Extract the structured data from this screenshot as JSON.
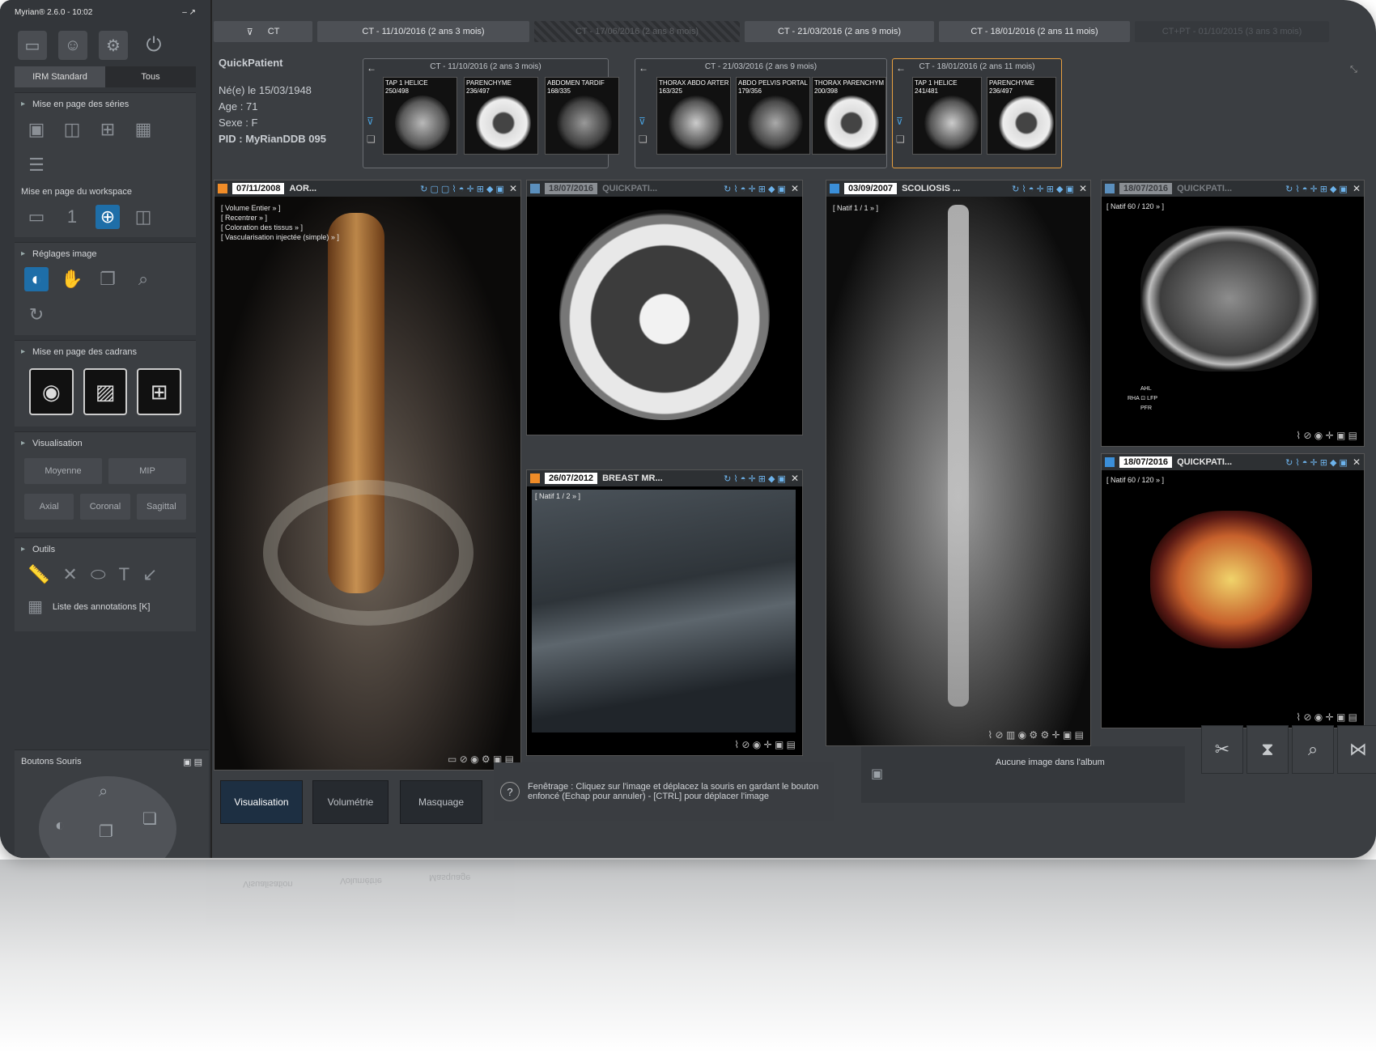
{
  "app": {
    "title": "Myrian® 2.6.0 - 10:02"
  },
  "sidebar": {
    "tabs": [
      "IRM Standard",
      "Tous"
    ],
    "main_icons": [
      "folder-icon",
      "user-icon",
      "settings-icon",
      "power-icon"
    ],
    "sections": {
      "series_layout": "Mise en page des séries",
      "workspace_layout": "Mise en page du workspace",
      "image_settings": "Réglages image",
      "frame_layout": "Mise en page des cadrans",
      "visualisation": "Visualisation",
      "tools": "Outils",
      "mouse_buttons": "Boutons Souris"
    },
    "workspace_selected": "1",
    "visualisation_buttons": [
      "Moyenne",
      "MIP",
      "Axial",
      "Coronal",
      "Sagittal"
    ],
    "annotations_label": "Liste des annotations [K]"
  },
  "study_tabs": [
    {
      "label": "CT",
      "state": "active"
    },
    {
      "label": "CT - 11/10/2016 (2 ans 3 mois)",
      "state": "normal"
    },
    {
      "label": "CT - 17/06/2016 (2 ans 8 mois)",
      "state": "hatched"
    },
    {
      "label": "CT - 21/03/2016 (2 ans 9 mois)",
      "state": "normal"
    },
    {
      "label": "CT - 18/01/2016 (2 ans 11 mois)",
      "state": "normal"
    },
    {
      "label": "CT+PT - 01/10/2015 (3 ans 3 mois)",
      "state": "dim"
    }
  ],
  "patient": {
    "name": "QuickPatient",
    "born": "Né(e) le 15/03/1948",
    "age": "Age : 71",
    "sex": "Sexe : F",
    "pid": "PID : MyRianDDB 095"
  },
  "series_groups": [
    {
      "title": "CT - 11/10/2016 (2 ans 3 mois)",
      "series": [
        {
          "label": "TAP 1 HELICE",
          "count": "250/498"
        },
        {
          "label": "PARENCHYME",
          "count": "236/497"
        },
        {
          "label": "ABDOMEN TARDIF",
          "count": "168/335"
        }
      ]
    },
    {
      "title": "CT - 21/03/2016 (2 ans 9 mois)",
      "series": [
        {
          "label": "THORAX ABDO ARTER",
          "count": "163/325"
        },
        {
          "label": "ABDO PELVIS PORTAL",
          "count": "179/356"
        },
        {
          "label": "THORAX PARENCHYM",
          "count": "200/398"
        }
      ]
    },
    {
      "title": "CT - 18/01/2016 (2 ans 11 mois)",
      "series": [
        {
          "label": "TAP 1 HELICE",
          "count": "241/481"
        },
        {
          "label": "PARENCHYME",
          "count": "236/497"
        }
      ]
    }
  ],
  "viewports": [
    {
      "date": "07/11/2008",
      "title": "AOR...",
      "overlay": [
        "[ Volume Entier » ]",
        "[ Recentrer » ]",
        "[ Coloration des tissus » ]",
        "[ Vascularisation injectée (simple) » ]"
      ]
    },
    {
      "date": "18/07/2016",
      "title": "QUICKPATI..."
    },
    {
      "date": "26/07/2012",
      "title": "BREAST MR...",
      "overlay": [
        "[ Natif 1 / 2 » ]"
      ]
    },
    {
      "date": "03/09/2007",
      "title": "SCOLIOSIS ...",
      "overlay": [
        "[ Natif 1 / 1 » ]"
      ]
    },
    {
      "date": "18/07/2016",
      "title": "QUICKPATI...",
      "overlay": [
        "[ Natif 60 / 120 » ]"
      ],
      "orientation": [
        "AHL",
        "RHA",
        "LFP",
        "PFR"
      ]
    },
    {
      "date": "18/07/2016",
      "title": "QUICKPATI...",
      "overlay": [
        "[ Natif 60 / 120 » ]"
      ]
    }
  ],
  "bottom": {
    "tabs": [
      "Visualisation",
      "Volumétrie",
      "Masquage"
    ],
    "help": "Fenêtrage : Cliquez sur l'image et déplacez la souris en gardant le bouton enfoncé (Echap pour annuler) - [CTRL] pour déplacer l'image",
    "album_empty": "Aucune image dans l'album"
  },
  "colors": {
    "accent_orange": "#f08c28",
    "accent_blue": "#3b8fd9",
    "selected_border": "#e8a040"
  }
}
